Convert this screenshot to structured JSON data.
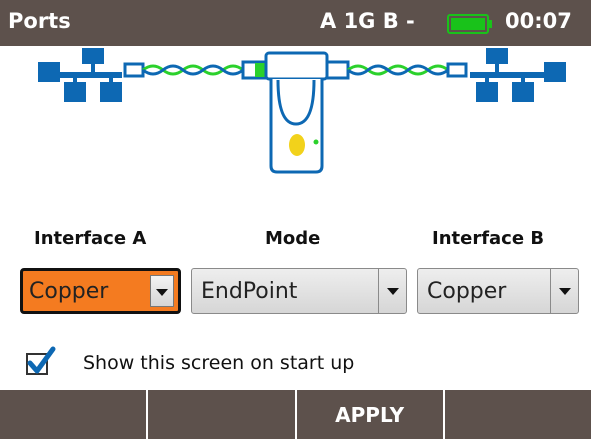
{
  "title_bar": {
    "app_title": "Ports",
    "link_status": "A 1G B -",
    "battery_icon": "battery-full-icon",
    "battery_color": "#19c21a",
    "clock": "00:07"
  },
  "diagram": {
    "left_icon": "network-icon",
    "right_icon": "network-icon",
    "device_icon": "tester-device-icon",
    "cable_icon": "twisted-pair-cable-icon",
    "accent_blue": "#0d68b3",
    "cable_green": "#2bd12b",
    "led_color": "#f2d21b"
  },
  "labels": {
    "interface_a": "Interface A",
    "mode": "Mode",
    "interface_b": "Interface B"
  },
  "dropdowns": {
    "interface_a": {
      "value": "Copper",
      "selected": true,
      "highlight": "#f47b20"
    },
    "mode": {
      "value": "EndPoint"
    },
    "interface_b": {
      "value": "Copper"
    }
  },
  "startup_option": {
    "checked": true,
    "label": "Show this screen on start up"
  },
  "softkeys": [
    "",
    "",
    "APPLY",
    ""
  ]
}
